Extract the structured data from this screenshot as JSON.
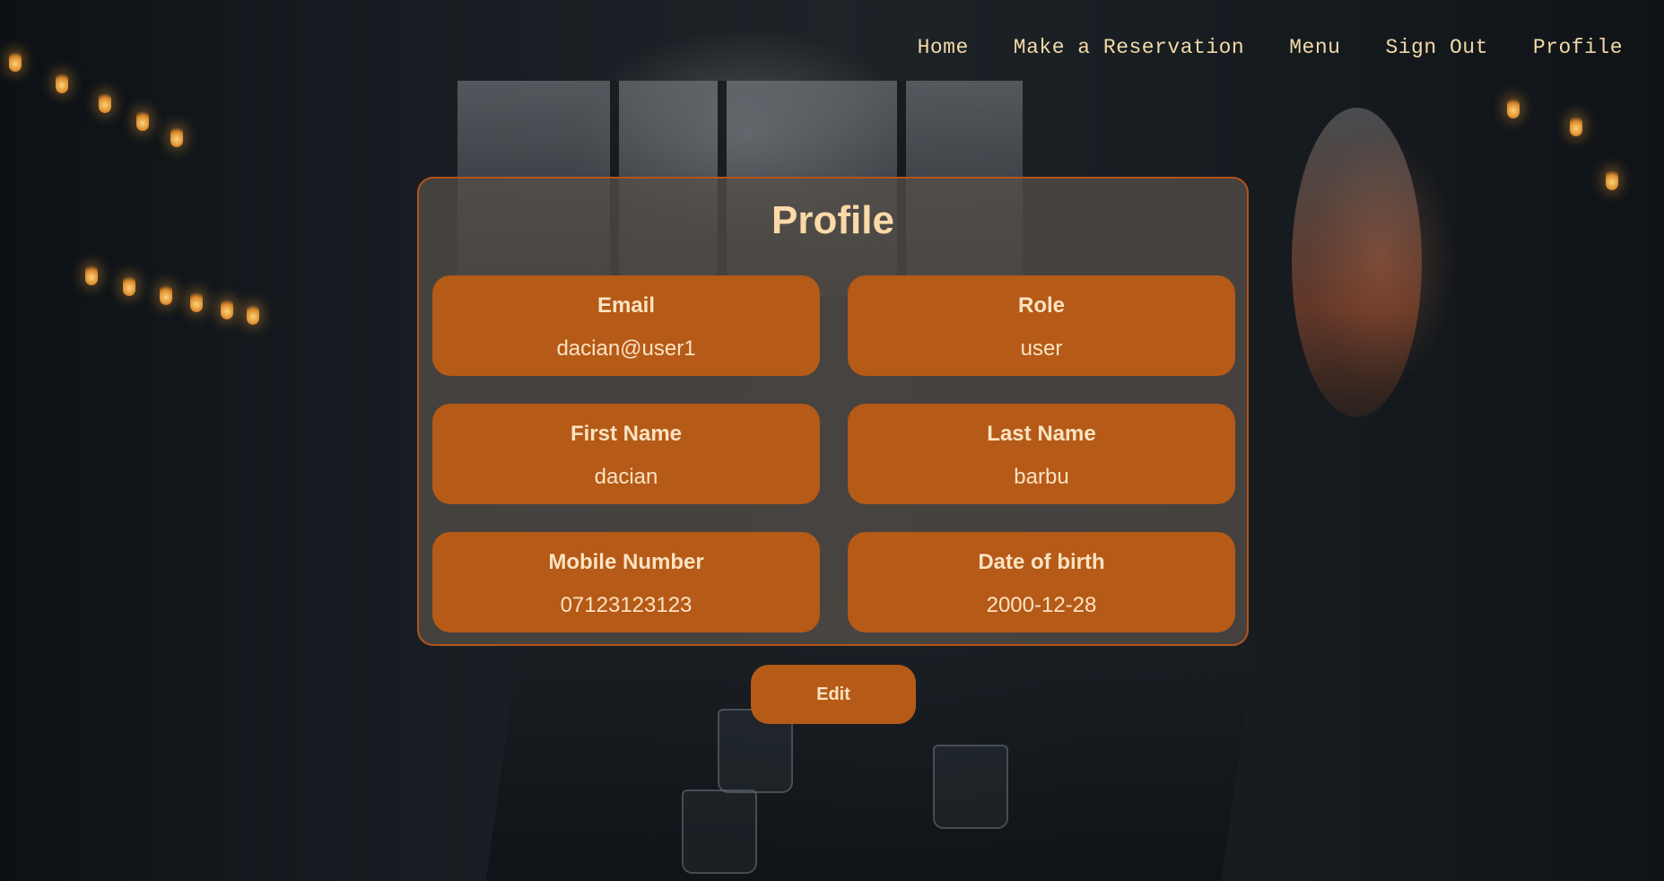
{
  "nav": {
    "items": [
      "Home",
      "Make a Reservation",
      "Menu",
      "Sign Out",
      "Profile"
    ]
  },
  "profile": {
    "title": "Profile",
    "fields": [
      {
        "label": "Email",
        "value": "dacian@user1"
      },
      {
        "label": "Role",
        "value": "user"
      },
      {
        "label": "First Name",
        "value": "dacian"
      },
      {
        "label": "Last Name",
        "value": "barbu"
      },
      {
        "label": "Mobile Number",
        "value": "07123123123"
      },
      {
        "label": "Date of birth",
        "value": "2000-12-28"
      }
    ],
    "edit_label": "Edit"
  },
  "colors": {
    "accent": "#b55a17",
    "text_light": "#fbe3c2",
    "title": "#fcd9a8",
    "nav_text": "#f2d9a6"
  }
}
